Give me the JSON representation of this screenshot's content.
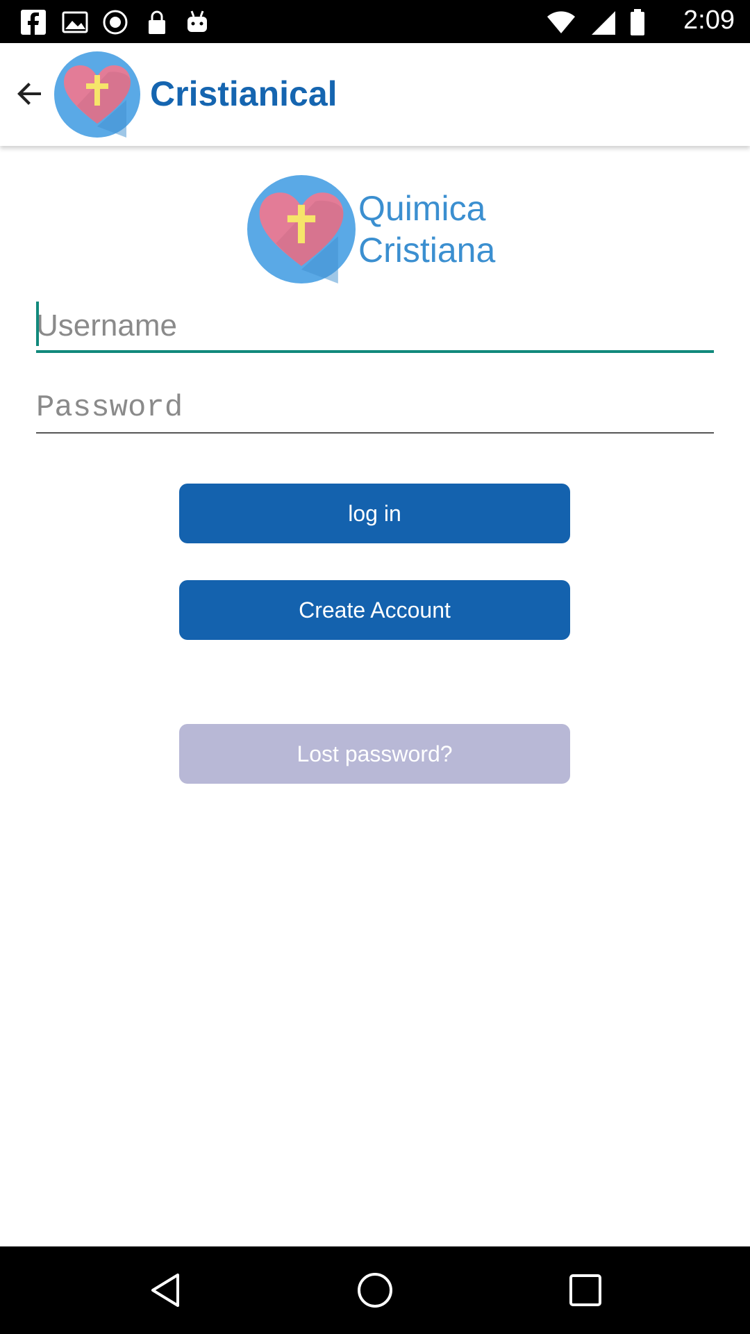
{
  "status_bar": {
    "time": "2:09",
    "notification_icons": [
      "facebook-icon",
      "gallery-icon",
      "circle-icon",
      "lock-icon",
      "android-icon"
    ],
    "system_icons": [
      "wifi-icon",
      "signal-icon",
      "battery-icon"
    ]
  },
  "app_bar": {
    "title": "Cristianical",
    "back_icon": "arrow-back-icon",
    "logo_icon": "heart-cross-logo"
  },
  "brand": {
    "line1": "Quimica",
    "line2": "Cristiana"
  },
  "form": {
    "username_placeholder": "Username",
    "password_placeholder": "Password"
  },
  "buttons": {
    "login": "log in",
    "create_account": "Create Account",
    "lost_password": "Lost password?"
  },
  "nav_bar": {
    "back": "nav-back-icon",
    "home": "nav-home-icon",
    "recents": "nav-recents-icon"
  },
  "colors": {
    "primary": "#1462ae",
    "title": "#1565b0",
    "accent": "#11897c",
    "disabled_button": "#b8b8d6",
    "logo_circle": "#5aa9e6",
    "logo_heart": "#e37c97"
  }
}
